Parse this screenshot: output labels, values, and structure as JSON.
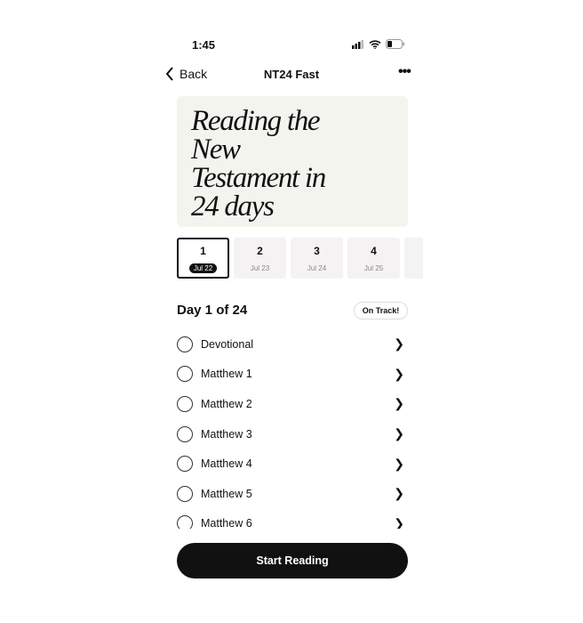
{
  "status_bar": {
    "time": "1:45"
  },
  "nav": {
    "back_label": "Back",
    "title": "NT24 Fast",
    "more_icon": "ellipsis-icon"
  },
  "hero": {
    "title": "Reading the New Testament in 24 days"
  },
  "days": [
    {
      "number": "1",
      "date": "Jul 22",
      "selected": true
    },
    {
      "number": "2",
      "date": "Jul 23",
      "selected": false
    },
    {
      "number": "3",
      "date": "Jul 24",
      "selected": false
    },
    {
      "number": "4",
      "date": "Jul 25",
      "selected": false
    },
    {
      "number": "",
      "date": "",
      "selected": false
    }
  ],
  "day_heading": "Day 1 of 24",
  "status_badge": "On Track!",
  "readings": [
    {
      "label": "Devotional"
    },
    {
      "label": "Matthew 1"
    },
    {
      "label": "Matthew 2"
    },
    {
      "label": "Matthew 3"
    },
    {
      "label": "Matthew 4"
    },
    {
      "label": "Matthew 5"
    },
    {
      "label": "Matthew 6"
    }
  ],
  "start_button": "Start Reading",
  "colors": {
    "hero_bg": "#f4f4ef",
    "primary": "#111111"
  }
}
